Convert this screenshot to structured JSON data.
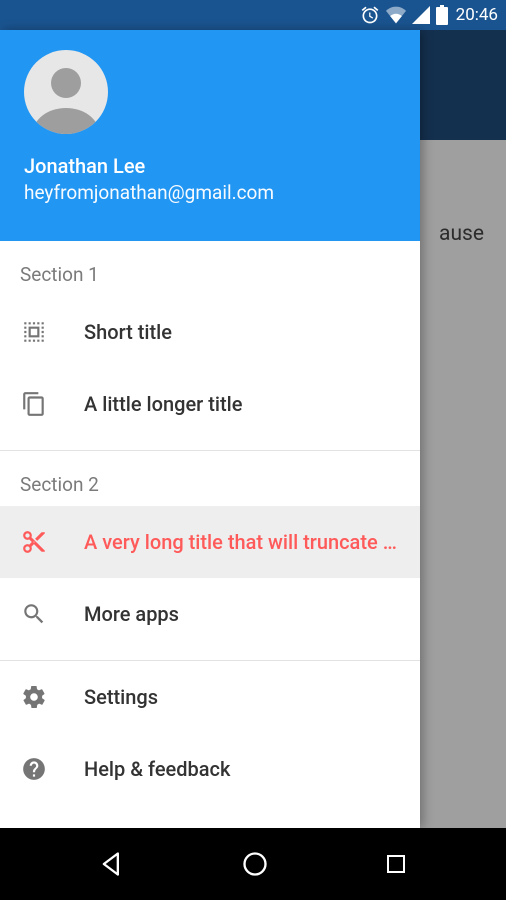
{
  "status": {
    "time": "20:46"
  },
  "peek_text": "ause",
  "drawer": {
    "user": {
      "name": "Jonathan Lee",
      "email": "heyfromjonathan@gmail.com"
    },
    "sections": [
      {
        "label": "Section 1",
        "items": [
          {
            "label": "Short title"
          },
          {
            "label": "A little longer title"
          }
        ]
      },
      {
        "label": "Section 2",
        "items": [
          {
            "label": "A very long title that will truncate because it is too long"
          },
          {
            "label": "More apps"
          }
        ]
      }
    ],
    "footer": [
      {
        "label": "Settings"
      },
      {
        "label": "Help & feedback"
      }
    ]
  }
}
